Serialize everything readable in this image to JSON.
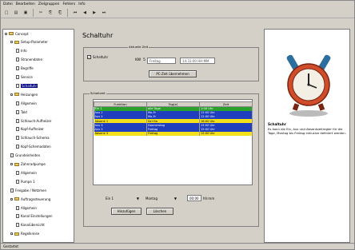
{
  "menu": [
    "Datei",
    "Bearbeiten",
    "Zielgruppen",
    "Fehlers",
    "Info"
  ],
  "toolbar": {
    "icons": [
      "new-icon",
      "open-icon",
      "save-icon",
      "cut-icon",
      "copy-icon",
      "paste-icon",
      "first-icon",
      "back-icon",
      "forward-icon",
      "last-icon"
    ],
    "labels": [
      "□",
      "▤",
      "▣",
      "✂",
      "⎘",
      "⎗",
      "⏮",
      "◀",
      "▶",
      "⏭"
    ]
  },
  "tree": {
    "items": [
      {
        "label": "Concept",
        "level": 0,
        "type": "folder",
        "expander": "-"
      },
      {
        "label": "Setup-Parameter",
        "level": 1,
        "type": "folder",
        "expander": "-"
      },
      {
        "label": "Info",
        "level": 2,
        "type": "file"
      },
      {
        "label": "Stranendaten",
        "level": 2,
        "type": "file"
      },
      {
        "label": "Begriffe",
        "level": 2,
        "type": "file"
      },
      {
        "label": "Service",
        "level": 2,
        "type": "file"
      },
      {
        "label": "Schaltuhr",
        "level": 2,
        "type": "file",
        "selected": true
      },
      {
        "label": "Heizungen",
        "level": 1,
        "type": "folder",
        "expander": "-"
      },
      {
        "label": "Allgemein",
        "level": 2,
        "type": "file"
      },
      {
        "label": "Takt",
        "level": 2,
        "type": "file"
      },
      {
        "label": "Schlauch-Aufheizer",
        "level": 2,
        "type": "file"
      },
      {
        "label": "Kopf-Aufheizer",
        "level": 2,
        "type": "file"
      },
      {
        "label": "Schlauch-Schema",
        "level": 2,
        "type": "file"
      },
      {
        "label": "Kopf-Schemadaten",
        "level": 2,
        "type": "file"
      },
      {
        "label": "Grundeinheiten",
        "level": 1,
        "type": "file"
      },
      {
        "label": "Zahnradpumpe",
        "level": 1,
        "type": "folder",
        "expander": "-"
      },
      {
        "label": "Allgemein",
        "level": 2,
        "type": "file"
      },
      {
        "label": "Pumpe 1",
        "level": 2,
        "type": "file"
      },
      {
        "label": "Freigabe / Netzmen",
        "level": 1,
        "type": "file"
      },
      {
        "label": "Auftragssteuerung",
        "level": 1,
        "type": "folder",
        "expander": "-"
      },
      {
        "label": "Allgemein",
        "level": 2,
        "type": "file"
      },
      {
        "label": "Kanal Einstellungen",
        "level": 2,
        "type": "file"
      },
      {
        "label": "Kanalübersicht",
        "level": 2,
        "type": "file"
      },
      {
        "label": "Regelkreise",
        "level": 1,
        "type": "folder",
        "expander": "+"
      }
    ]
  },
  "main": {
    "title": "Schaltuhr",
    "aktuelle_zeit": {
      "group_label": "Aktuelle Zeit",
      "checkbox_label": "Schaltuhr",
      "kw_label": "KW",
      "kw_value": "5",
      "day_value": "Freitag",
      "time_value": "14:31:00 HH:MM",
      "pc_button": "PC-Zeit übernehmen"
    },
    "schaltzeit": {
      "group_label": "Schaltzeit",
      "headers": [
        "Funktion",
        "Tag(e)",
        "Zeit"
      ],
      "rows": [
        {
          "funktion": "Ein 1",
          "tage": "alle Tage",
          "zeit": "1:00 Uhr",
          "bg": "#2ca02c",
          "fg": "#ffffff"
        },
        {
          "funktion": "Aus 1",
          "tage": "Mo-Fr",
          "zeit": "12:00 Uhr",
          "bg": "#1f3fbf",
          "fg": "#ffffff"
        },
        {
          "funktion": "Aus 2",
          "tage": "Mo-Fr",
          "zeit": "12:00 Uhr",
          "bg": "#1f3fbf",
          "fg": "#ffffff"
        },
        {
          "funktion": "Absenk 1",
          "tage": "Sa+So",
          "zeit": "16:00 Uhr",
          "bg": "#f5e11a",
          "fg": "#000000"
        },
        {
          "funktion": "Aus 3",
          "tage": "Donnerstag",
          "zeit": "15:00 Uhr",
          "bg": "#1f3fbf",
          "fg": "#ffffff"
        },
        {
          "funktion": "Aus 3",
          "tage": "Freitag",
          "zeit": "15:00 Uhr",
          "bg": "#1f3fbf",
          "fg": "#ffffff"
        },
        {
          "funktion": "Absenk 3",
          "tage": "Freitag",
          "zeit": "15:00 Uhr",
          "bg": "#f5e11a",
          "fg": "#000000"
        }
      ]
    },
    "bottom": {
      "funktion_select": "Ein 1",
      "tag_select": "Montag",
      "time_value": "00:00",
      "time_unit": "hh:mm",
      "add_button": "Hinzufügen",
      "delete_button": "Löschen"
    }
  },
  "info_panel": {
    "title": "Schaltuhr",
    "text": "Es kann die Ein, Aus und Absenkzeitregler für die Tage, Montag bis Freitag inklusive definiert werden."
  },
  "status": "Gestartet"
}
